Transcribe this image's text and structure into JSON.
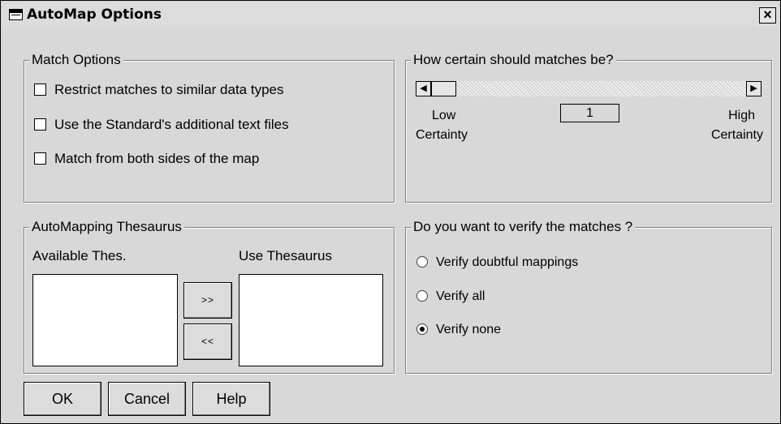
{
  "window": {
    "title": "AutoMap Options"
  },
  "match_options": {
    "legend": "Match Options",
    "items": [
      {
        "label": "Restrict matches to similar data types",
        "checked": false
      },
      {
        "label": "Use the Standard's additional text files",
        "checked": false
      },
      {
        "label": "Match from both sides of the map",
        "checked": false
      }
    ]
  },
  "certainty": {
    "legend": "How certain should matches be?",
    "value": "1",
    "low_label_1": "Low",
    "low_label_2": "Certainty",
    "high_label_1": "High",
    "high_label_2": "Certainty"
  },
  "thesaurus": {
    "legend": "AutoMapping Thesaurus",
    "available_label": "Available Thes.",
    "use_label": "Use Thesaurus",
    "add_label": ">>",
    "remove_label": "<<"
  },
  "verify": {
    "legend": "Do you want to verify the matches ?",
    "options": [
      {
        "label": "Verify doubtful mappings",
        "selected": false
      },
      {
        "label": "Verify all",
        "selected": false
      },
      {
        "label": "Verify none",
        "selected": true
      }
    ]
  },
  "buttons": {
    "ok": "OK",
    "cancel": "Cancel",
    "help": "Help"
  }
}
